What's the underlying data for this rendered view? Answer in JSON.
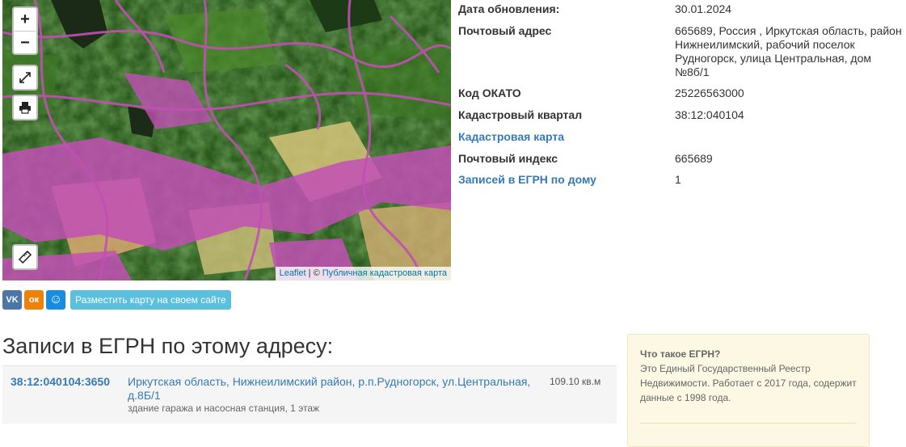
{
  "map": {
    "zoom_in": "+",
    "zoom_out": "−",
    "attribution_leaflet": "Leaflet",
    "attribution_sep": " | © ",
    "attribution_source": "Публичная кадастровая карта"
  },
  "info": {
    "rows": [
      {
        "label": "Дата обновления:",
        "value": "30.01.2024",
        "link": false
      },
      {
        "label": "Почтовый адрес",
        "value": "665689, Россия , Иркутская область, район Нижнеилимский, рабочий поселок Рудногорск, улица Центральная, дом №8б/1",
        "link": false
      },
      {
        "label": "Код ОКАТО",
        "value": "25226563000",
        "link": false
      },
      {
        "label": "Кадастровый квартал",
        "value": "38:12:040104",
        "link": false
      },
      {
        "label": "Кадастровая карта",
        "value": "",
        "link": true
      },
      {
        "label": "Почтовый индекс",
        "value": "665689",
        "link": false
      },
      {
        "label": "Записей в ЕГРН по дому",
        "value": "1",
        "link": true
      }
    ]
  },
  "share": {
    "vk": "VK",
    "ok": "ок",
    "mr": "☺",
    "embed_label": "Разместить карту на своем сайте"
  },
  "records": {
    "title": "Записи в ЕГРН по этому адресу:",
    "items": [
      {
        "number": "38:12:040104:3650",
        "address": "Иркутская область, Нижнеилимский район, р.п.Рудногорск, ул.Центральная, д.8Б/1",
        "area": "109.10 кв.м",
        "description": "здание гаража и насосная станция, 1 этаж"
      }
    ]
  },
  "egrn_box": {
    "question": "Что такое ЕГРН?",
    "answer": "Это Единый Государственный Реестр Недвижимости. Работает с 2017 года, содержит данные с 1998 года."
  },
  "colors": {
    "link": "#337ab7",
    "cadastral_pink": "#c24fb5",
    "forest": "#2f5a1f",
    "embed_button": "#5bc0de"
  },
  "icons": {
    "fullscreen": "fullscreen-icon",
    "print": "print-icon",
    "ruler": "ruler-icon"
  }
}
